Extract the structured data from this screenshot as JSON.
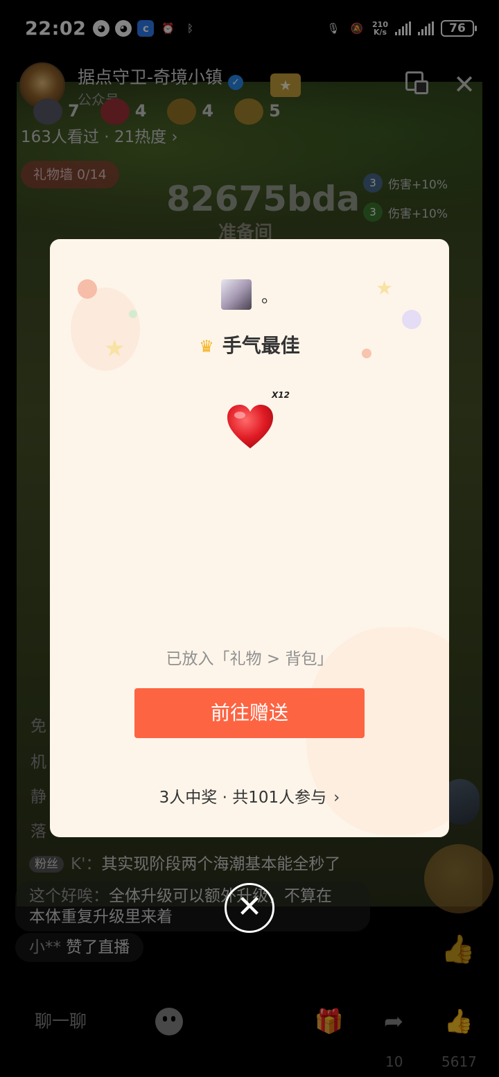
{
  "status": {
    "time": "22:02",
    "netspeed_top": "210",
    "netspeed_bottom": "K/s",
    "battery": "76"
  },
  "room": {
    "title": "据点守卫-奇境小镇",
    "subtitle": "公众号",
    "viewers": "163人看过 · 21热度 ›",
    "gift_wall": "礼物墙 0/14"
  },
  "game": {
    "stats": [
      "7",
      "4",
      "4",
      "5"
    ],
    "room_code": "82675bda",
    "prep_room": "准备间",
    "buffs": [
      {
        "level": "3",
        "text": "伤害+10%"
      },
      {
        "level": "3",
        "text": "伤害+10%"
      }
    ]
  },
  "chat": {
    "partial": [
      "免",
      "机",
      "静",
      "落"
    ],
    "fan_badge": "粉丝",
    "line1_name": "K'：",
    "line1_text": "其实现阶段两个海潮基本能全秒了",
    "line2_name": "这个好唉：",
    "line2_text": "全体升级可以额外升级，不算在",
    "line2_cont": "本体重复升级里来着",
    "line3_name": "小**",
    "line3_text": " 赞了直播"
  },
  "bottom": {
    "chat_entry": "聊一聊",
    "share_count": "10",
    "like_count": "5617"
  },
  "modal": {
    "winner_name": "。",
    "best_luck": "手气最佳",
    "prize_qty": "X12",
    "placed_note": "已放入「礼物 > 背包」",
    "go_send": "前往赠送",
    "summary": "3人中奖 · 共101人参与"
  },
  "colors": {
    "accent_button": "#fd6442",
    "modal_bg": "#fef5ea",
    "crown": "#f5b21b"
  }
}
